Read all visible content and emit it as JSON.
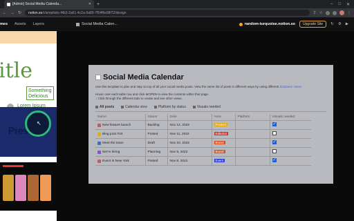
{
  "browser": {
    "tab_title": "[Admin] Social Media Calenda...",
    "new_tab": "+",
    "url_host": "notion.so",
    "url_path": "/r/simplistic-f4b3-2a61-4c2a-9a89-7f54f6e98f72/design",
    "window_controls": [
      "–",
      "□",
      "✕"
    ]
  },
  "appbar": {
    "tabs": [
      "mes",
      "Assets",
      "Layers"
    ],
    "page_title": "Social Media Calen...",
    "site": "random-turquoise.notion.so",
    "upgrade": "Upgrade Site"
  },
  "thumbnails": {
    "thumb2_big": "itle",
    "thumb2_box": "Something Delicious",
    "thumb2_lorem": "Lorem Ipsum",
    "thumb3_text": "Prese"
  },
  "page": {
    "title": "Social Media Calendar",
    "desc1": "Use this template to plan and stay on top of all your social media posts. View the same list of posts in different ways by using different",
    "desc1_link": "database views.",
    "desc2": "Hover over each table row and click ⊕OPEN to view the contents within that page.",
    "desc3": "↓ Click through the different tabs to create and see other views.",
    "views": [
      {
        "label": "All posts",
        "active": true
      },
      {
        "label": "Calendar view",
        "active": false
      },
      {
        "label": "Platform by status",
        "active": false
      },
      {
        "label": "Visuals needed",
        "active": false
      }
    ],
    "columns": [
      "Name",
      "Status",
      "Date",
      "Area",
      "Platform",
      "Visuals needed"
    ],
    "rows": [
      {
        "name": "New feature launch",
        "status": "Backlog",
        "date": "Nov 12, 2022",
        "area": "Product",
        "area_color": "#e6a817",
        "icon_color": "#d9534f",
        "visuals": true
      },
      {
        "name": "Blog post #10",
        "status": "Posted",
        "date": "Nov 11, 2022",
        "area": "Editorial",
        "area_color": "#d62d2d",
        "icon_color": "#e6a817",
        "visuals": false
      },
      {
        "name": "Meet the team",
        "status": "Draft",
        "date": "Nov 10, 2022",
        "area": "Brand",
        "area_color": "#d9501e",
        "icon_color": "#3b6fd8",
        "visuals": true
      },
      {
        "name": "We're hiring",
        "status": "Planning",
        "date": "Nov 9, 2022",
        "area": "Brand",
        "area_color": "#d9501e",
        "icon_color": "#7a5ac8",
        "visuals": false
      },
      {
        "name": "Event in New York",
        "status": "Posted",
        "date": "Nov 8, 2022",
        "area": "Event",
        "area_color": "#2d3bd6",
        "icon_color": "#d9534f",
        "visuals": true
      }
    ]
  }
}
